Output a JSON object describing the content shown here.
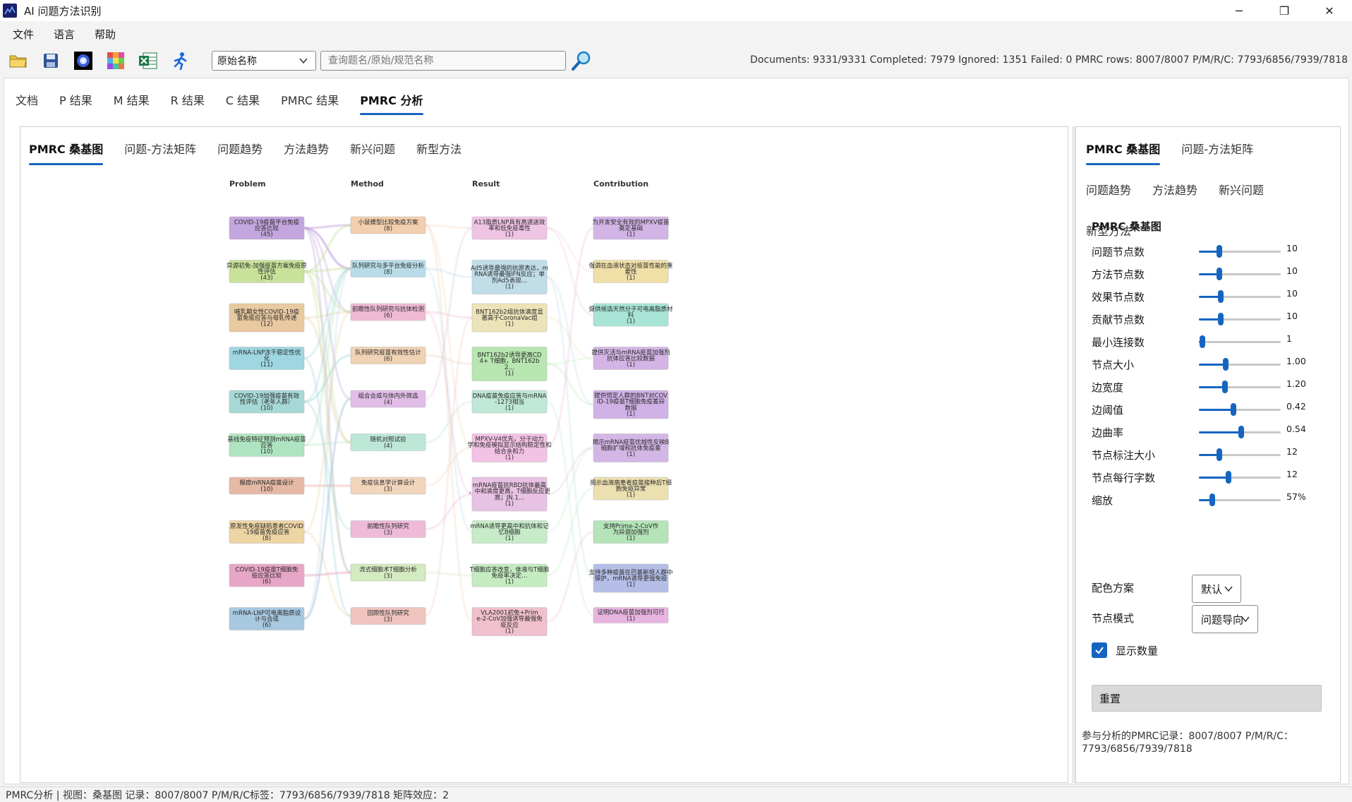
{
  "window": {
    "title": "AI 问题方法识别",
    "minimize": "─",
    "maximize": "❐",
    "close": "✕"
  },
  "menu": {
    "items": [
      "文件",
      "语言",
      "帮助"
    ]
  },
  "toolbar": {
    "field_select": "原始名称",
    "search_placeholder": "查询题名/原始/规范名称",
    "status": "Documents: 9331/9331  Completed: 7979  Ignored: 1351  Failed: 0  PMRC rows: 8007/8007  P/M/R/C: 7793/6856/7939/7818"
  },
  "top_tabs": [
    "文档",
    "P 结果",
    "M 结果",
    "R 结果",
    "C 结果",
    "PMRC 结果",
    "PMRC 分析"
  ],
  "active_top_tab": "PMRC 分析",
  "sub_tabs": [
    "PMRC 桑基图",
    "问题-方法矩阵",
    "问题趋势",
    "方法趋势",
    "新兴问题",
    "新型方法"
  ],
  "active_sub_tab": "PMRC 桑基图",
  "chart_data": {
    "type": "sankey",
    "columns": [
      "Problem",
      "Method",
      "Result",
      "Contribution"
    ],
    "nodes": [
      [
        {
          "label": "COVID-19疫苗平台免疫应答比较",
          "count": "(45)",
          "color": "#c3a6de"
        },
        {
          "label": "异源初免-加强疫苗方案免疫原性评估",
          "count": "(43)",
          "color": "#c8e29a"
        },
        {
          "label": "哺乳期女性COVID-19疫苗免疫应答与母乳传递",
          "count": "(12)",
          "color": "#e8c9a0"
        },
        {
          "label": "mRNA-LNP冻干稳定性优化",
          "count": "(11)",
          "color": "#9ed6e2"
        },
        {
          "label": "COVID-19加强疫苗有效性评估（老年人群）",
          "count": "(10)",
          "color": "#a6d9d6"
        },
        {
          "label": "基线免疫特征预测mRNA疫苗应答",
          "count": "(10)",
          "color": "#aee4c0"
        },
        {
          "label": "猴痘mRNA疫苗设计",
          "count": "(10)",
          "color": "#e6b9a6"
        },
        {
          "label": "原发性免疫缺陷患者COVID-19疫苗免疫应答",
          "count": "(8)",
          "color": "#eed5a4"
        },
        {
          "label": "COVID-19疫苗T细胞免疫应答比较",
          "count": "(6)",
          "color": "#e8a6c6"
        },
        {
          "label": "mRNA-LNP可电离脂质设计与合成",
          "count": "(6)",
          "color": "#a8c8e0"
        }
      ],
      [
        {
          "label": "小鼠模型比较免疫方案",
          "count": "(8)",
          "color": "#f2cfae"
        },
        {
          "label": "队列研究与多平台免疫分析",
          "count": "(8)",
          "color": "#b9dde8"
        },
        {
          "label": "前瞻性队列研究与抗体检测",
          "count": "(6)",
          "color": "#eebad4"
        },
        {
          "label": "队列研究疫苗有效性估计",
          "count": "(6)",
          "color": "#f0d2b4"
        },
        {
          "label": "组合合成与体内外筛选",
          "count": "(4)",
          "color": "#e2bde8"
        },
        {
          "label": "随机对照试验",
          "count": "(4)",
          "color": "#bde8d8"
        },
        {
          "label": "免疫信息学计算设计",
          "count": "(3)",
          "color": "#f2d6bc"
        },
        {
          "label": "前瞻性队列研究",
          "count": "(3)",
          "color": "#eebad8"
        },
        {
          "label": "流式细胞术T细胞分析",
          "count": "(3)",
          "color": "#d4eac0"
        },
        {
          "label": "回顾性队列研究",
          "count": "(3)",
          "color": "#f0c4be"
        }
      ],
      [
        {
          "label": "A13脂质LNP具有高递送效率和低免疫毒性",
          "count": "(1)",
          "color": "#f0c4e4"
        },
        {
          "label": "Ad5诱导最强的抗原表达，mRNA诱导最强IFN反应；单剂Ad5表现…",
          "count": "(1)",
          "color": "#c0dde8"
        },
        {
          "label": "BNT162b2组抗体滴度显著高于CoronaVac组",
          "count": "(1)",
          "color": "#ece4b8"
        },
        {
          "label": "BNT162b2诱导更高CD4+ T细胞，BNT162b2…",
          "count": "(1)",
          "color": "#b8e6b0"
        },
        {
          "label": "DNA疫苗免疫应答与mRNA-1273相当",
          "count": "(1)",
          "color": "#bfe8d6"
        },
        {
          "label": "MPXV-V4优先，分子动力学和免疫模拟显示结构稳定性和结合亲和力",
          "count": "(1)",
          "color": "#f2c2e4"
        },
        {
          "label": "mRNA疫苗抗RBD抗体最高，中和滴度更高，T细胞反应更高；JN.1…",
          "count": "(1)",
          "color": "#e8c2e4"
        },
        {
          "label": "mRNA诱导更高中和抗体和记忆B细胞",
          "count": "(1)",
          "color": "#c6ecc8"
        },
        {
          "label": "T细胞应答改变，体液与T细胞免疫率决定…",
          "count": "(1)",
          "color": "#c4ecc0"
        },
        {
          "label": "VLA2001初免+Prime-2-CoV加强诱导最强免疫反应",
          "count": "(1)",
          "color": "#f0c0cc"
        }
      ],
      [
        {
          "label": "为开发安全有效的MPXV疫苗奠定基础",
          "count": "(1)",
          "color": "#d2b4e6"
        },
        {
          "label": "强调在血液状态对疫苗性能的重要性",
          "count": "(1)",
          "color": "#f0e0a8"
        },
        {
          "label": "提供候选天然分子可电离脂质材料",
          "count": "(1)",
          "color": "#a8e4d6"
        },
        {
          "label": "提供灭活与mRNA疫苗加强剂抗体应答比较数据",
          "count": "(1)",
          "color": "#d4b4e6"
        },
        {
          "label": "提供恒定人群的BNT对COVID-19疫苗T细胞免疫差异数据",
          "count": "(1)",
          "color": "#d0b2e6"
        },
        {
          "label": "揭示mRNA疫苗优越性反映B细胞扩增和抗体免疫差",
          "count": "(1)",
          "color": "#d4b6e6"
        },
        {
          "label": "揭示血液病患者疫苗接种后T细胞免疫异常",
          "count": "(1)",
          "color": "#ece0b0"
        },
        {
          "label": "支持Prime-2-CoV作为异源加强剂",
          "count": "(1)",
          "color": "#b4e4b8"
        },
        {
          "label": "支持多种疫苗在巴基斯坦人群中保护，mRNA诱导更强免疫",
          "count": "(1)",
          "color": "#b4bee6"
        },
        {
          "label": "证明DNA疫苗加强剂可行",
          "count": "(1)",
          "color": "#e8b4e0"
        }
      ]
    ]
  },
  "right_panel": {
    "tabs": [
      "PMRC 桑基图",
      "问题-方法矩阵",
      "问题趋势",
      "方法趋势",
      "新兴问题",
      "新型方法"
    ],
    "active_tab": "PMRC 桑基图",
    "heading": "PMRC 桑基图",
    "sliders": [
      {
        "label": "问题节点数",
        "value": "10",
        "fraction": 0.25
      },
      {
        "label": "方法节点数",
        "value": "10",
        "fraction": 0.25
      },
      {
        "label": "效果节点数",
        "value": "10",
        "fraction": 0.27
      },
      {
        "label": "贡献节点数",
        "value": "10",
        "fraction": 0.27
      },
      {
        "label": "最小连接数",
        "value": "1",
        "fraction": 0.04
      },
      {
        "label": "节点大小",
        "value": "1.00",
        "fraction": 0.33
      },
      {
        "label": "边宽度",
        "value": "1.20",
        "fraction": 0.32
      },
      {
        "label": "边阈值",
        "value": "0.42",
        "fraction": 0.42
      },
      {
        "label": "边曲率",
        "value": "0.54",
        "fraction": 0.52
      },
      {
        "label": "节点标注大小",
        "value": "12",
        "fraction": 0.25
      },
      {
        "label": "节点每行字数",
        "value": "12",
        "fraction": 0.36
      },
      {
        "label": "缩放",
        "value": "57%",
        "fraction": 0.16
      }
    ],
    "color_scheme_label": "配色方案",
    "color_scheme_value": "默认",
    "node_mode_label": "节点模式",
    "node_mode_value": "问题导向",
    "show_count_label": "显示数量",
    "show_count_checked": true,
    "reset_label": "重置",
    "footer": "参与分析的PMRC记录：8007/8007  P/M/R/C：7793/6856/7939/7818"
  },
  "statusbar": {
    "text": "PMRC分析 | 视图：桑基图  记录：8007/8007  P/M/R/C标签：7793/6856/7939/7818  矩阵效应：2"
  }
}
